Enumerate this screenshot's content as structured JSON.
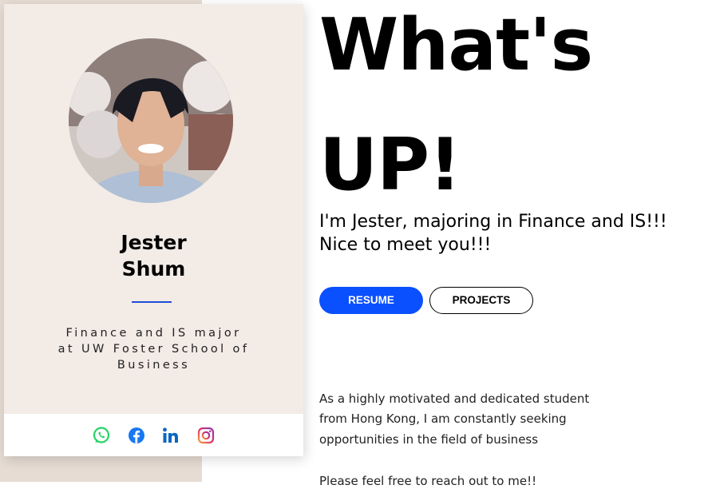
{
  "profile": {
    "avatar_icon": "profile-photo",
    "first_name": "Jester",
    "last_name": "Shum",
    "tagline_lines": [
      "Finance and IS major",
      "at UW Foster School of",
      "Business"
    ],
    "accent_color": "#1f4fd8"
  },
  "social": [
    {
      "icon": "whatsapp-icon",
      "color": "#25d366"
    },
    {
      "icon": "facebook-icon",
      "color": "#1877f2"
    },
    {
      "icon": "linkedin-icon",
      "color": "#0a66c2"
    },
    {
      "icon": "instagram-icon",
      "color": "#c13584"
    }
  ],
  "hero": {
    "headline_line1": "What's",
    "headline_line2": "UP!",
    "intro_line1": "I'm Jester, majoring in Finance and IS!!!",
    "intro_line2": "Nice to meet you!!!"
  },
  "actions": {
    "resume_label": "RESUME",
    "projects_label": "PROJECTS",
    "primary_color": "#0b50ff"
  },
  "about": {
    "line1": "As a highly motivated and dedicated student",
    "line2": "from Hong Kong, I am constantly seeking",
    "line3": "opportunities in the field of business",
    "line4": "Please feel free to reach out to me!!"
  }
}
